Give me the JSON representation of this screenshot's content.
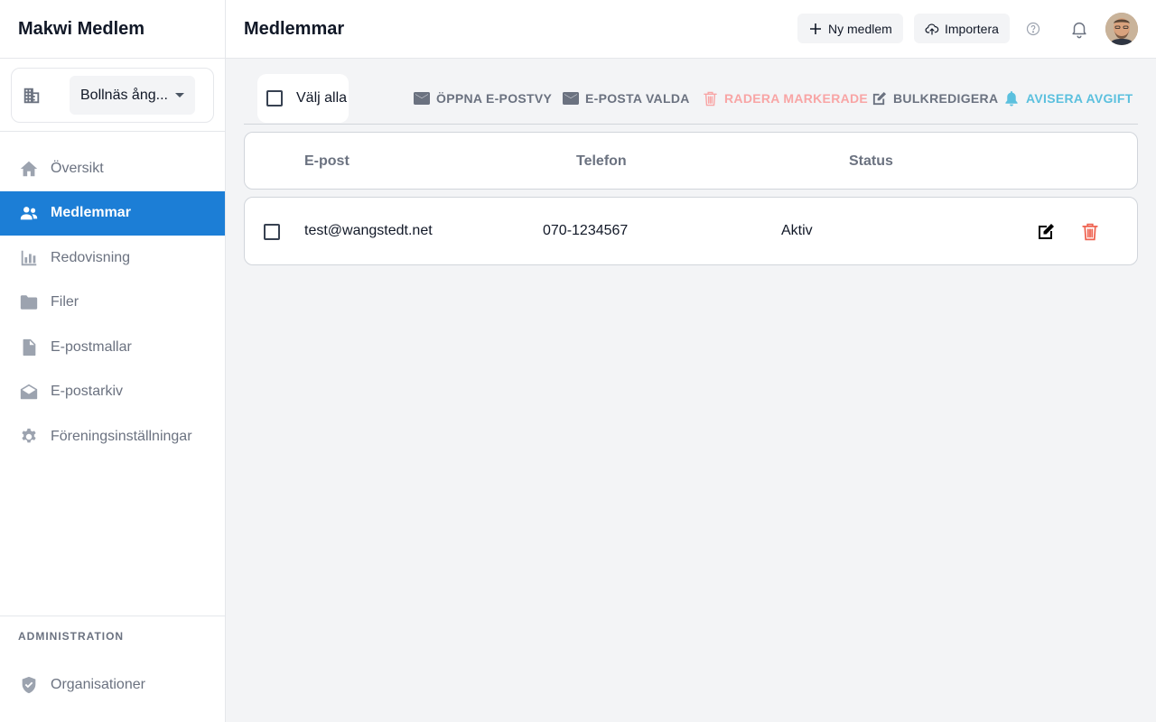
{
  "sidebar": {
    "brand": "Makwi Medlem",
    "org_selector": {
      "value": "Bollnäs ång..."
    },
    "nav": [
      {
        "label": "Översikt",
        "icon": "home-icon"
      },
      {
        "label": "Medlemmar",
        "icon": "users-icon",
        "active": true
      },
      {
        "label": "Redovisning",
        "icon": "bar-chart-icon"
      },
      {
        "label": "Filer",
        "icon": "folder-icon"
      },
      {
        "label": "E-postmallar",
        "icon": "document-icon"
      },
      {
        "label": "E-postarkiv",
        "icon": "envelope-open-icon"
      },
      {
        "label": "Föreningsinställningar",
        "icon": "gear-icon"
      }
    ],
    "admin": {
      "heading": "ADMINISTRATION",
      "items": [
        {
          "label": "Organisationer",
          "icon": "shield-check-icon"
        }
      ]
    }
  },
  "header": {
    "title": "Medlemmar",
    "new_member": "Ny medlem",
    "import": "Importera"
  },
  "toolbar": {
    "select_all": "Välj alla",
    "actions": {
      "open_email_view": "ÖPPNA E-POSTVY",
      "email_selected": "E-POSTA VALDA",
      "delete_selected": "RADERA MARKERADE",
      "bulk_edit": "BULKREDIGERA",
      "notify_fee": "AVISERA AVGIFT"
    }
  },
  "table": {
    "columns": {
      "email": "E-post",
      "phone": "Telefon",
      "status": "Status"
    },
    "rows": [
      {
        "email": "test@wangstedt.net",
        "phone": "070-1234567",
        "status": "Aktiv"
      }
    ]
  },
  "colors": {
    "accent": "#1c7ed6",
    "danger": "#f87171",
    "info": "#38bdf8",
    "muted": "#6b7280"
  }
}
